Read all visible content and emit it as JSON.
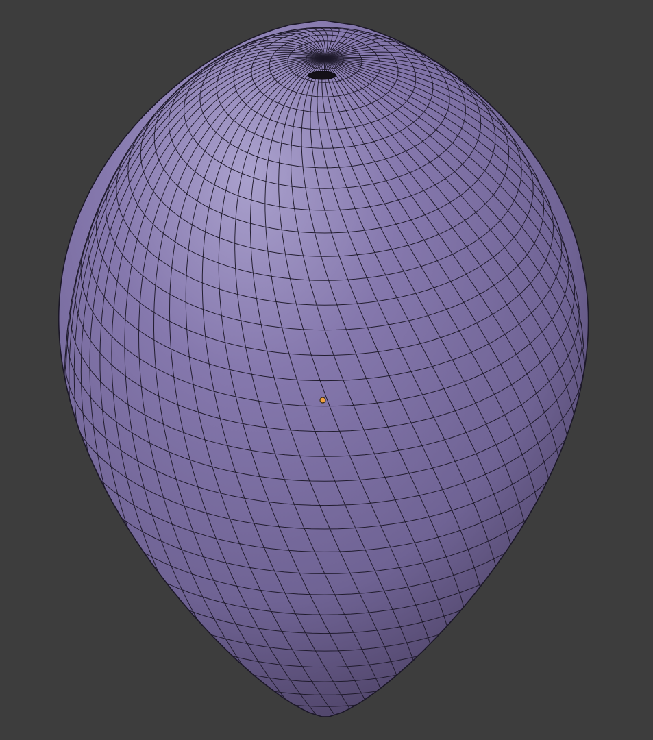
{
  "viewport": {
    "background": "#3d3d3d"
  },
  "mesh": {
    "name": "",
    "shape": "egg-shaped subdivided UV sphere, shaded solid with wireframe overlay",
    "base_color": "#7e70a6",
    "highlight_color": "#aaa1cd",
    "shadow_color": "#4d4266",
    "wire_color": "#1c1828"
  },
  "origin_point": {
    "color": "#f0a040",
    "outline_color": "#3a2a10"
  }
}
